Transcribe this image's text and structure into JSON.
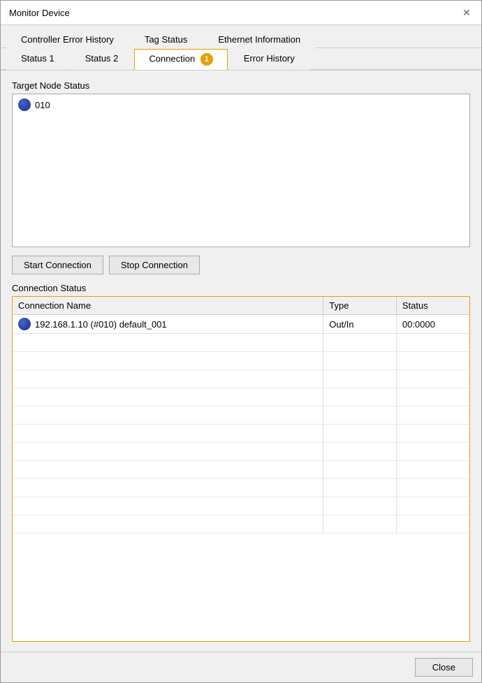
{
  "window": {
    "title": "Monitor Device"
  },
  "tabs_row1": {
    "items": [
      {
        "id": "controller-error-history",
        "label": "Controller Error History",
        "active": false
      },
      {
        "id": "tag-status",
        "label": "Tag Status",
        "active": false
      },
      {
        "id": "ethernet-information",
        "label": "Ethernet Information",
        "active": false
      }
    ]
  },
  "tabs_row2": {
    "items": [
      {
        "id": "status1",
        "label": "Status 1",
        "active": false
      },
      {
        "id": "status2",
        "label": "Status 2",
        "active": false
      },
      {
        "id": "connection",
        "label": "Connection",
        "active": true,
        "badge": "1"
      },
      {
        "id": "error-history",
        "label": "Error History",
        "active": false
      }
    ]
  },
  "target_node_status": {
    "label": "Target Node Status",
    "nodes": [
      {
        "id": "node-010",
        "label": "010"
      }
    ]
  },
  "buttons": {
    "start_connection": "Start Connection",
    "stop_connection": "Stop Connection"
  },
  "connection_status": {
    "label": "Connection Status",
    "table": {
      "headers": [
        "Connection Name",
        "Type",
        "Status"
      ],
      "rows": [
        {
          "name": "192.168.1.10 (#010) default_001",
          "type": "Out/In",
          "status": "00:0000",
          "has_icon": true
        }
      ]
    }
  },
  "footer": {
    "close_label": "Close"
  }
}
